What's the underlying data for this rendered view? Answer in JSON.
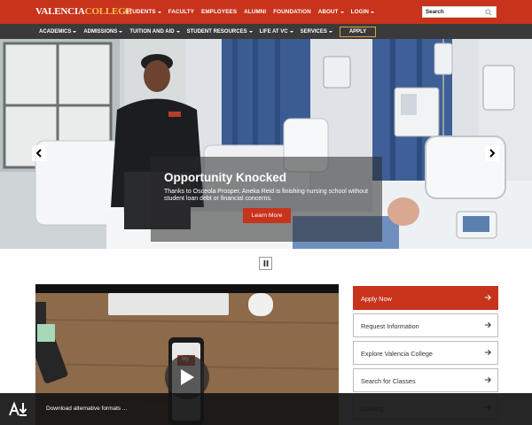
{
  "header": {
    "logo_part1": "VALENCIA",
    "logo_part2": "COLLEGE",
    "nav": [
      {
        "label": "STUDENTS",
        "dropdown": true
      },
      {
        "label": "FACULTY",
        "dropdown": false
      },
      {
        "label": "EMPLOYEES",
        "dropdown": false
      },
      {
        "label": "ALUMNI",
        "dropdown": false
      },
      {
        "label": "FOUNDATION",
        "dropdown": false
      },
      {
        "label": "ABOUT",
        "dropdown": true
      },
      {
        "label": "LOGIN",
        "dropdown": true
      }
    ],
    "search_label": "Search"
  },
  "subnav": {
    "items": [
      {
        "label": "ACADEMICS",
        "dropdown": true
      },
      {
        "label": "ADMISSIONS",
        "dropdown": true
      },
      {
        "label": "TUITION AND AID",
        "dropdown": true
      },
      {
        "label": "STUDENT RESOURCES",
        "dropdown": true
      },
      {
        "label": "LIFE AT VC",
        "dropdown": true
      },
      {
        "label": "SERVICES",
        "dropdown": true
      }
    ],
    "apply_label": "APPLY"
  },
  "hero": {
    "title": "Opportunity Knocked",
    "text": "Thanks to Osceola Prosper, Aneka Reid is finishing nursing school without student loan debt or financial concerns.",
    "button_label": "Learn More"
  },
  "quick_links": [
    {
      "label": "Apply Now",
      "primary": true
    },
    {
      "label": "Request Information",
      "primary": false
    },
    {
      "label": "Explore Valencia College",
      "primary": false
    },
    {
      "label": "Search for Classes",
      "primary": false
    },
    {
      "label": "Catalog",
      "primary": false
    }
  ],
  "video": {
    "phone_badge": "My"
  },
  "alt_formats": {
    "text": "Download alternative formats ..."
  },
  "colors": {
    "brand_red": "#c8331c",
    "nav_dark": "#3a3a3a",
    "logo_gold": "#f6c14a"
  }
}
